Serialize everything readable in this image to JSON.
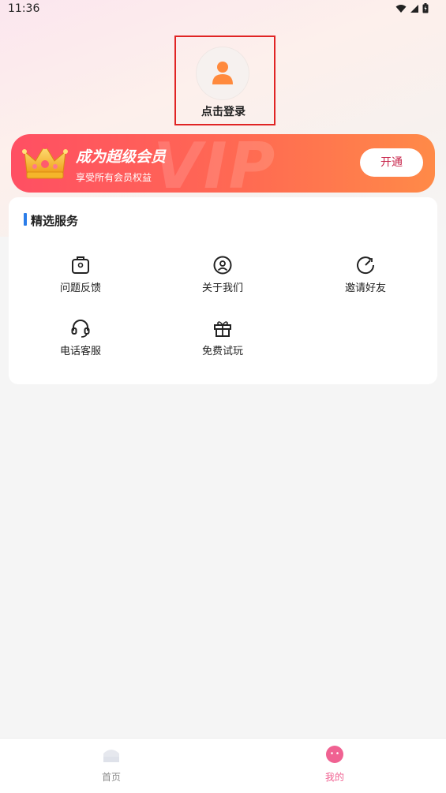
{
  "status_bar": {
    "time": "11:36"
  },
  "profile": {
    "login_label": "点击登录"
  },
  "vip": {
    "title": "成为超级会员",
    "subtitle": "享受所有会员权益",
    "button_label": "开通",
    "watermark": "VIP"
  },
  "services": {
    "section_title": "精选服务",
    "items": [
      {
        "label": "问题反馈",
        "icon": "feedback-icon"
      },
      {
        "label": "关于我们",
        "icon": "about-icon"
      },
      {
        "label": "邀请好友",
        "icon": "invite-icon"
      },
      {
        "label": "电话客服",
        "icon": "headset-icon"
      },
      {
        "label": "免费试玩",
        "icon": "gift-icon"
      }
    ]
  },
  "tabbar": {
    "items": [
      {
        "label": "首页",
        "icon": "home-icon",
        "active": false
      },
      {
        "label": "我的",
        "icon": "mine-icon",
        "active": true
      }
    ]
  },
  "colors": {
    "accent": "#2b7de9",
    "vip_start": "#ff4f63",
    "vip_end": "#ff8a48",
    "avatar": "#ff8a3d",
    "tab_active": "#f06292",
    "tab_inactive": "#8a8a8a",
    "highlight_box": "#e02424"
  }
}
